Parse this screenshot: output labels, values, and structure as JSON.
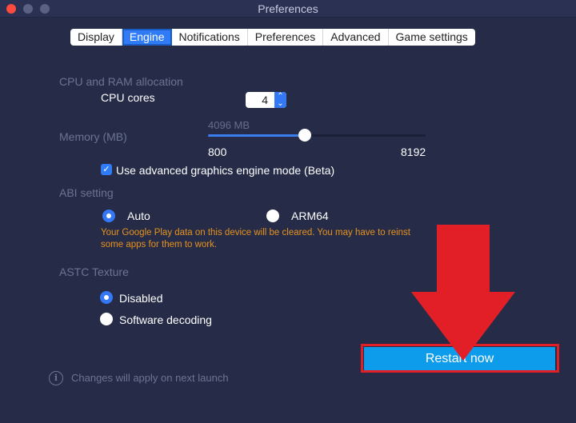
{
  "window": {
    "title": "Preferences",
    "controls": [
      "close",
      "minimize",
      "maximize"
    ]
  },
  "tabs": [
    {
      "label": "Display",
      "active": false
    },
    {
      "label": "Engine",
      "active": true
    },
    {
      "label": "Notifications",
      "active": false
    },
    {
      "label": "Preferences",
      "active": false
    },
    {
      "label": "Advanced",
      "active": false
    },
    {
      "label": "Game settings",
      "active": false
    }
  ],
  "cpu_ram": {
    "section_label": "CPU and RAM allocation",
    "cpu_cores_label": "CPU cores",
    "cpu_cores_value": "4",
    "memory_label": "Memory (MB)",
    "memory_value_text": "4096 MB",
    "memory_value": 4096,
    "memory_min": 800,
    "memory_max": 8192,
    "memory_min_label": "800",
    "memory_max_label": "8192",
    "advanced_graphics_label": "Use advanced graphics engine mode (Beta)",
    "advanced_graphics_checked": true
  },
  "abi": {
    "section_label": "ABI setting",
    "options": [
      {
        "label": "Auto",
        "checked": true
      },
      {
        "label": "ARM64",
        "checked": false
      }
    ],
    "warning_line1": "Your Google Play data on this device will be cleared. You may have to reinst",
    "warning_line2": "some apps for them to work."
  },
  "astc": {
    "section_label": "ASTC Texture",
    "options": [
      {
        "label": "Disabled",
        "checked": true
      },
      {
        "label": "Software decoding",
        "checked": false
      }
    ]
  },
  "footer": {
    "info_icon": "i",
    "info_text": "Changes will apply on next launch",
    "restart_label": "Restart now"
  },
  "annotation": {
    "arrow_color": "#e21f26",
    "highlight_color": "#e21f26"
  },
  "colors": {
    "accent": "#2f7cf6",
    "button": "#0d9cec",
    "warning": "#e6921d",
    "background": "#262c48"
  }
}
